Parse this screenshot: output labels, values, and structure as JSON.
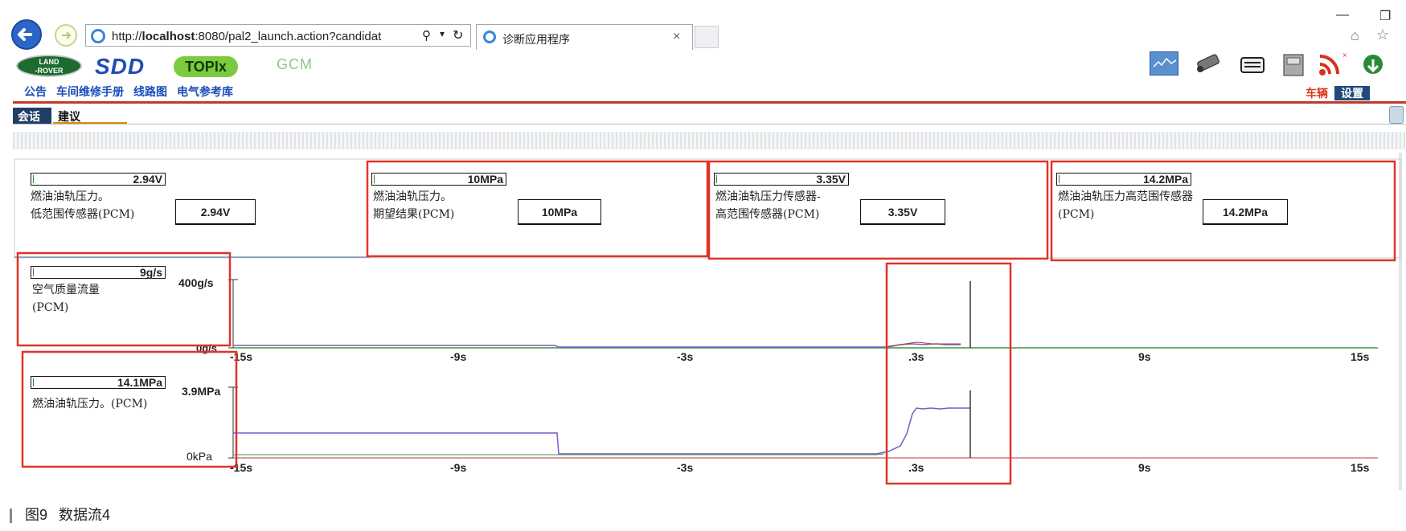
{
  "browser": {
    "url_prefix": "http://",
    "url_host": "localhost",
    "url_rest": ":8080/pal2_launch.action?candidat",
    "search_glyph": "⚲",
    "tab_title": "诊断应用程序",
    "tab_close": "×"
  },
  "app": {
    "logo_landrover": "LAND\n-ROVER",
    "logo_sdd": "SDD",
    "logo_topix": "TOPIx",
    "logo_gcm": "GCM",
    "links": [
      "公告",
      "车间维修手册",
      "线路图",
      "电气参考库"
    ],
    "vehicle_label": "车辆",
    "settings_label": "设置"
  },
  "subtabs": {
    "session": "会话",
    "advice": "建议"
  },
  "params": [
    {
      "value": "2.94V",
      "name_line1": "燃油油轨压力。",
      "name_line2": "低范围传感器(PCM)",
      "box": "2.94V"
    },
    {
      "value": "10MPa",
      "name_line1": "燃油油轨压力。",
      "name_line2": "期望结果(PCM)",
      "box": "10MPa"
    },
    {
      "value": "3.35V",
      "name_line1": "燃油油轨压力传感器-",
      "name_line2": "高范围传感器(PCM)",
      "box": "3.35V"
    },
    {
      "value": "14.2MPa",
      "name_line1": "燃油油轨压力高范围传感器",
      "name_line2": "(PCM)",
      "box": "14.2MPa"
    }
  ],
  "graphs": [
    {
      "value": "9g/s",
      "name_line1": "空气质量流量",
      "name_line2": "(PCM)",
      "y_max": "400g/s",
      "y_min": "0g/s"
    },
    {
      "value": "14.1MPa",
      "name_line1": "燃油油轨压力。(PCM)",
      "name_line2": "",
      "y_max": "3.9MPa",
      "y_min": "0kPa"
    }
  ],
  "x_ticks": [
    "-15s",
    "-9s",
    "-3s",
    ".3s",
    "9s",
    "15s"
  ],
  "caption": {
    "figure": "图9",
    "title": "数据流4"
  },
  "colors": {
    "highlight": "#e03328",
    "accent_blue": "#1f4fb3",
    "trace_purple": "#7b59c9",
    "trace_green": "#3b9a3b",
    "trace_red": "#b23a3a"
  }
}
